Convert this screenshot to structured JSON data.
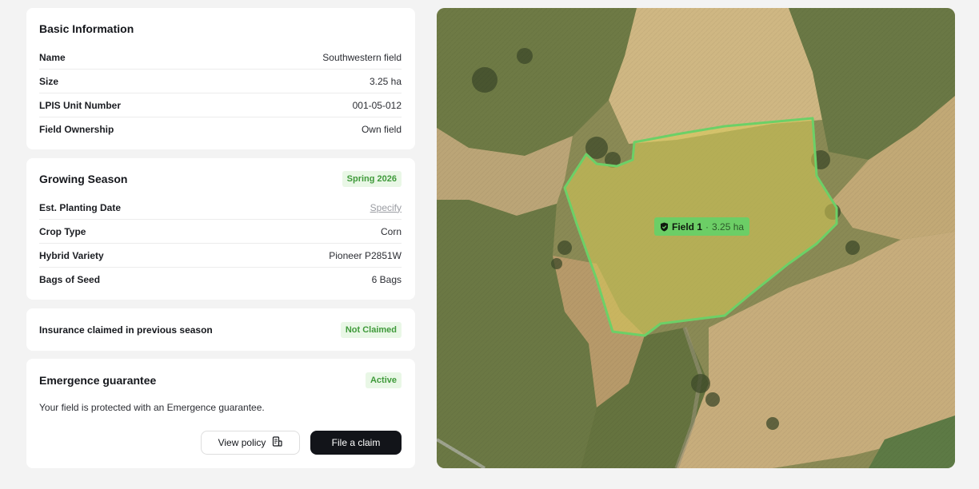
{
  "basic_info": {
    "title": "Basic Information",
    "rows": [
      {
        "label": "Name",
        "value": "Southwestern field"
      },
      {
        "label": "Size",
        "value": "3.25 ha"
      },
      {
        "label": "LPIS Unit Number",
        "value": "001-05-012"
      },
      {
        "label": "Field Ownership",
        "value": "Own field"
      }
    ]
  },
  "growing_season": {
    "title": "Growing Season",
    "badge": "Spring 2026",
    "rows": [
      {
        "label": "Est. Planting Date",
        "value": "Specify"
      },
      {
        "label": "Crop Type",
        "value": "Corn"
      },
      {
        "label": "Hybrid Variety",
        "value": "Pioneer P2851W"
      },
      {
        "label": "Bags of Seed",
        "value": "6 Bags"
      }
    ]
  },
  "insurance": {
    "label": "Insurance claimed in previous season",
    "badge": "Not Claimed"
  },
  "emergence": {
    "title": "Emergence guarantee",
    "badge": "Active",
    "description": "Your field is protected with an Emergence guarantee.",
    "view_policy_label": "View policy",
    "file_claim_label": "File a claim"
  },
  "map": {
    "field_name": "Field 1",
    "separator": "·",
    "field_size": "3.25 ha",
    "boundary_color": "#6cd067",
    "shield_icon": "shield-check-icon",
    "document_icon": "document-icon"
  }
}
